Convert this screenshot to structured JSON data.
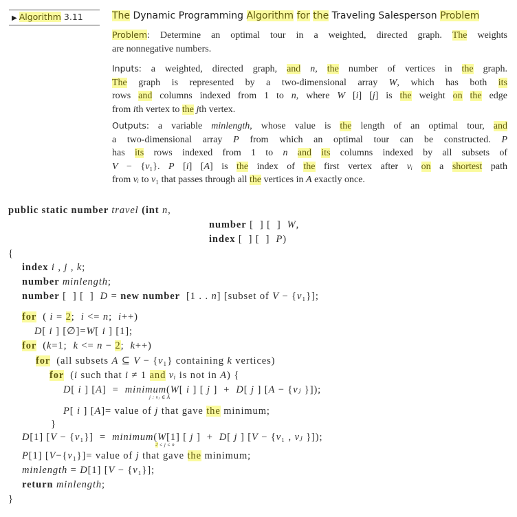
{
  "header": {
    "algorithm_prefix": "Algorithm",
    "algorithm_number": "3.11",
    "arrow_icon": "triangle-right-icon",
    "title_segments": [
      {
        "t": "The",
        "hl": true
      },
      {
        "t": " Dynamic Programming ",
        "hl": false
      },
      {
        "t": "Algorithm",
        "hl": true
      },
      {
        "t": " ",
        "hl": false
      },
      {
        "t": "for",
        "hl": true
      },
      {
        "t": " ",
        "hl": false
      },
      {
        "t": "the",
        "hl": true
      },
      {
        "t": " Traveling Salesperson ",
        "hl": false
      },
      {
        "t": "Problem",
        "hl": true
      }
    ]
  },
  "problem": {
    "label": "Problem",
    "lines": [
      [
        {
          "t": ": Determine an optimal tour in a weighted, directed graph. "
        },
        {
          "t": "The",
          "hl": true
        },
        {
          "t": " weights"
        }
      ],
      [
        {
          "t": "are nonnegative numbers."
        }
      ]
    ]
  },
  "inputs": {
    "label": "Inputs",
    "lines": [
      [
        {
          "t": ": a weighted, directed graph, "
        },
        {
          "t": "and",
          "hl": true
        },
        {
          "t": " "
        },
        {
          "t": "n",
          "it": true
        },
        {
          "t": ", "
        },
        {
          "t": "the",
          "hl": true
        },
        {
          "t": " number of vertices in "
        },
        {
          "t": "the",
          "hl": true
        },
        {
          "t": " graph."
        }
      ],
      [
        {
          "t": "The",
          "hl": true
        },
        {
          "t": " graph is represented by a two-dimensional array "
        },
        {
          "t": "W",
          "it": true
        },
        {
          "t": ", which has both "
        },
        {
          "t": "its",
          "hl": true
        }
      ],
      [
        {
          "t": "rows "
        },
        {
          "t": "and",
          "hl": true
        },
        {
          "t": " columns indexed from 1 to "
        },
        {
          "t": "n",
          "it": true
        },
        {
          "t": ", where "
        },
        {
          "t": "W",
          "it": true
        },
        {
          "t": " ["
        },
        {
          "t": "i",
          "it": true
        },
        {
          "t": "] ["
        },
        {
          "t": "j",
          "it": true
        },
        {
          "t": "] is "
        },
        {
          "t": "the",
          "hl": true
        },
        {
          "t": " weight "
        },
        {
          "t": "on",
          "hl": true
        },
        {
          "t": " "
        },
        {
          "t": "the",
          "hl": true
        },
        {
          "t": " edge"
        }
      ],
      [
        {
          "t": "from "
        },
        {
          "t": "i",
          "it": true
        },
        {
          "t": "th vertex to "
        },
        {
          "t": "the",
          "hl": true
        },
        {
          "t": " "
        },
        {
          "t": "j",
          "it": true
        },
        {
          "t": "th vertex."
        }
      ]
    ]
  },
  "outputs": {
    "label": "Outputs",
    "lines": [
      [
        {
          "t": ": a variable "
        },
        {
          "t": "minlength",
          "it": true
        },
        {
          "t": ", whose value is "
        },
        {
          "t": "the",
          "hl": true
        },
        {
          "t": " length of an optimal tour, "
        },
        {
          "t": "and",
          "hl": true
        }
      ],
      [
        {
          "t": "a two-dimensional array "
        },
        {
          "t": "P",
          "it": true
        },
        {
          "t": " from which an optimal tour can be constructed. "
        },
        {
          "t": "P",
          "it": true
        }
      ],
      [
        {
          "t": "has "
        },
        {
          "t": "its",
          "hl": true
        },
        {
          "t": " rows indexed from 1 to "
        },
        {
          "t": "n",
          "it": true
        },
        {
          "t": " "
        },
        {
          "t": "and",
          "hl": true
        },
        {
          "t": " "
        },
        {
          "t": "its",
          "hl": true
        },
        {
          "t": " columns indexed by all subsets of"
        }
      ],
      [
        {
          "t": "V",
          "it": true
        },
        {
          "t": " − {"
        },
        {
          "t": "v",
          "it": true
        },
        {
          "t": "₁}. "
        },
        {
          "t": "P",
          "it": true
        },
        {
          "t": " ["
        },
        {
          "t": "i",
          "it": true
        },
        {
          "t": "] ["
        },
        {
          "t": "A",
          "it": true
        },
        {
          "t": "] is "
        },
        {
          "t": "the",
          "hl": true
        },
        {
          "t": " index of "
        },
        {
          "t": "the",
          "hl": true
        },
        {
          "t": " first vertex after "
        },
        {
          "t": "vᵢ",
          "it": true
        },
        {
          "t": " "
        },
        {
          "t": "on",
          "hl": true
        },
        {
          "t": " a "
        },
        {
          "t": "shortest",
          "hl": true
        },
        {
          "t": " path"
        }
      ],
      [
        {
          "t": "from "
        },
        {
          "t": "vᵢ",
          "it": true
        },
        {
          "t": " to "
        },
        {
          "t": "v",
          "it": true
        },
        {
          "t": "₁ that passes through all "
        },
        {
          "t": "the",
          "hl": true
        },
        {
          "t": " vertices in "
        },
        {
          "t": "A",
          "it": true
        },
        {
          "t": " exactly once."
        }
      ]
    ]
  },
  "code": {
    "lines": [
      {
        "indent": 0,
        "seg": [
          {
            "t": "public static number ",
            "b": true
          },
          {
            "t": "travel",
            "it": true
          },
          {
            "t": " (int ",
            "b": true
          },
          {
            "t": "n",
            "it": true
          },
          {
            "t": ","
          }
        ]
      },
      {
        "indent": 292,
        "seg": [
          {
            "t": "number",
            "b": true
          },
          {
            "t": " [  ] [  ]  "
          },
          {
            "t": "W",
            "it": true
          },
          {
            "t": ","
          }
        ]
      },
      {
        "indent": 292,
        "seg": [
          {
            "t": "index",
            "b": true
          },
          {
            "t": " [  ] [  ]  "
          },
          {
            "t": "P",
            "it": true
          },
          {
            "t": ")"
          }
        ]
      },
      {
        "indent": 0,
        "seg": [
          {
            "t": "{"
          }
        ]
      },
      {
        "indent": 20,
        "seg": [
          {
            "t": "index ",
            "b": true
          },
          {
            "t": "i",
            "it": true
          },
          {
            "t": " , "
          },
          {
            "t": "j",
            "it": true
          },
          {
            "t": " , "
          },
          {
            "t": "k",
            "it": true
          },
          {
            "t": ";"
          }
        ]
      },
      {
        "indent": 20,
        "seg": [
          {
            "t": "number ",
            "b": true
          },
          {
            "t": "minlength",
            "it": true
          },
          {
            "t": ";"
          }
        ]
      },
      {
        "indent": 20,
        "seg": [
          {
            "t": "number",
            "b": true
          },
          {
            "t": " [  ] [  ]  "
          },
          {
            "t": "D",
            "it": true
          },
          {
            "t": " = "
          },
          {
            "t": "new number",
            "b": true
          },
          {
            "t": "  [1 . . "
          },
          {
            "t": "n",
            "it": true
          },
          {
            "t": "] [subset of "
          },
          {
            "t": "V",
            "it": true
          },
          {
            "t": " − {"
          },
          {
            "t": "v",
            "it": true
          },
          {
            "t": "₁}];"
          }
        ]
      },
      {
        "indent": 20,
        "seg": [
          {
            "t": "for",
            "b": true,
            "hl": true
          },
          {
            "t": "  ( "
          },
          {
            "t": "i",
            "it": true
          },
          {
            "t": " = "
          },
          {
            "t": "2",
            "hl": true
          },
          {
            "t": ";  "
          },
          {
            "t": "i",
            "it": true
          },
          {
            "t": " <= "
          },
          {
            "t": "n",
            "it": true
          },
          {
            "t": ";  "
          },
          {
            "t": "i",
            "it": true
          },
          {
            "t": "++)"
          }
        ]
      },
      {
        "indent": 38,
        "seg": [
          {
            "t": "D",
            "it": true
          },
          {
            "t": "[ "
          },
          {
            "t": "i",
            "it": true
          },
          {
            "t": " ] [∅]="
          },
          {
            "t": "W",
            "it": true
          },
          {
            "t": "[ "
          },
          {
            "t": "i",
            "it": true
          },
          {
            "t": " ] [1];"
          }
        ]
      },
      {
        "indent": 20,
        "seg": [
          {
            "t": "for",
            "b": true,
            "hl": true
          },
          {
            "t": "  ("
          },
          {
            "t": "k",
            "it": true
          },
          {
            "t": "=1;  "
          },
          {
            "t": "k",
            "it": true
          },
          {
            "t": " <= "
          },
          {
            "t": "n",
            "it": true
          },
          {
            "t": " − "
          },
          {
            "t": "2",
            "hl": true
          },
          {
            "t": ";  "
          },
          {
            "t": "k",
            "it": true
          },
          {
            "t": "++)"
          }
        ]
      },
      {
        "indent": 40,
        "seg": [
          {
            "t": "for",
            "b": true,
            "hl": true
          },
          {
            "t": "  (all subsets "
          },
          {
            "t": "A",
            "it": true
          },
          {
            "t": " ⊆ "
          },
          {
            "t": "V",
            "it": true
          },
          {
            "t": " − {"
          },
          {
            "t": "v",
            "it": true
          },
          {
            "t": "₁} containing "
          },
          {
            "t": "k",
            "it": true
          },
          {
            "t": " vertices)"
          }
        ]
      },
      {
        "indent": 60,
        "seg": [
          {
            "t": "for",
            "b": true,
            "hl": true
          },
          {
            "t": "  ("
          },
          {
            "t": "i",
            "it": true
          },
          {
            "t": " such that "
          },
          {
            "t": "i",
            "it": true
          },
          {
            "t": " ≠ 1 "
          },
          {
            "t": "and",
            "hl": true
          },
          {
            "t": " "
          },
          {
            "t": "vᵢ",
            "it": true
          },
          {
            "t": " is not in "
          },
          {
            "t": "A",
            "it": true
          },
          {
            "t": ") {"
          }
        ]
      },
      {
        "indent": 80,
        "seg": [
          {
            "t": "D",
            "it": true
          },
          {
            "t": "[ "
          },
          {
            "t": "i",
            "it": true
          },
          {
            "t": " ] ["
          },
          {
            "t": "A",
            "it": true
          },
          {
            "t": "]  =  "
          },
          {
            "t": "minimum",
            "it": true
          },
          {
            "t": "("
          },
          {
            "t": "W",
            "it": true
          },
          {
            "t": "[ "
          },
          {
            "t": "i",
            "it": true
          },
          {
            "t": " ] [ "
          },
          {
            "t": "j",
            "it": true
          },
          {
            "t": " ]  +  "
          },
          {
            "t": "D",
            "it": true
          },
          {
            "t": "[ "
          },
          {
            "t": "j",
            "it": true
          },
          {
            "t": " ] ["
          },
          {
            "t": "A",
            "it": true
          },
          {
            "t": " − {"
          },
          {
            "t": "vⱼ",
            "it": true
          },
          {
            "t": " }]);"
          }
        ]
      },
      {
        "indent": 80,
        "seg": [
          {
            "t": "P",
            "it": true
          },
          {
            "t": "[ "
          },
          {
            "t": "i",
            "it": true
          },
          {
            "t": " ] ["
          },
          {
            "t": "A",
            "it": true
          },
          {
            "t": "]= value of "
          },
          {
            "t": "j",
            "it": true
          },
          {
            "t": " that gave "
          },
          {
            "t": "the",
            "hl": true
          },
          {
            "t": " minimum;"
          }
        ]
      },
      {
        "indent": 62,
        "seg": [
          {
            "t": "}"
          }
        ]
      },
      {
        "indent": 20,
        "seg": [
          {
            "t": "D",
            "it": true
          },
          {
            "t": "[1] ["
          },
          {
            "t": "V",
            "it": true
          },
          {
            "t": " − {"
          },
          {
            "t": "v",
            "it": true
          },
          {
            "t": "₁}]  =  "
          },
          {
            "t": "minimum",
            "it": true
          },
          {
            "t": "("
          },
          {
            "t": "W",
            "it": true
          },
          {
            "t": "[1] [ "
          },
          {
            "t": "j",
            "it": true
          },
          {
            "t": " ]  +  "
          },
          {
            "t": "D",
            "it": true
          },
          {
            "t": "[ "
          },
          {
            "t": "j",
            "it": true
          },
          {
            "t": " ] ["
          },
          {
            "t": "V",
            "it": true
          },
          {
            "t": " − {"
          },
          {
            "t": "v",
            "it": true
          },
          {
            "t": "₁ , "
          },
          {
            "t": "vⱼ",
            "it": true
          },
          {
            "t": " }]);"
          }
        ]
      },
      {
        "indent": 20,
        "seg": [
          {
            "t": "P",
            "it": true
          },
          {
            "t": "[1] ["
          },
          {
            "t": "V",
            "it": true
          },
          {
            "t": "−{"
          },
          {
            "t": "v",
            "it": true
          },
          {
            "t": "₁}]= value of "
          },
          {
            "t": "j",
            "it": true
          },
          {
            "t": " that gave "
          },
          {
            "t": "the",
            "hl": true
          },
          {
            "t": " minimum;"
          }
        ]
      },
      {
        "indent": 20,
        "seg": [
          {
            "t": "minlength",
            "it": true
          },
          {
            "t": " = "
          },
          {
            "t": "D",
            "it": true
          },
          {
            "t": "[1] ["
          },
          {
            "t": "V",
            "it": true
          },
          {
            "t": " − {"
          },
          {
            "t": "v",
            "it": true
          },
          {
            "t": "₁}];"
          }
        ]
      },
      {
        "indent": 20,
        "seg": [
          {
            "t": "return ",
            "b": true
          },
          {
            "t": "minlength",
            "it": true
          },
          {
            "t": ";"
          }
        ]
      },
      {
        "indent": 0,
        "seg": [
          {
            "t": "}"
          }
        ]
      }
    ],
    "subscripts": [
      {
        "line": 12,
        "text": "j : vⱼ ∈ A"
      },
      {
        "line": 15,
        "text": "2 ≤ j ≤ n",
        "hl_first": true
      }
    ]
  },
  "colors": {
    "highlight": "#fafa9e",
    "highlight_text": "#5f5a10",
    "text": "#2b2b2b"
  }
}
